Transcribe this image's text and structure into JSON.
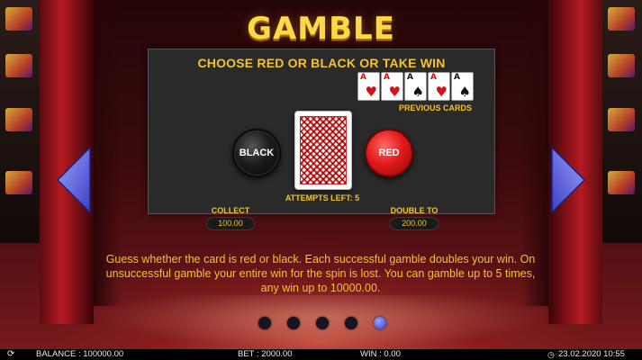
{
  "title": "GAMBLE",
  "panel": {
    "heading": "CHOOSE RED OR BLACK OR TAKE WIN",
    "previous_cards_label": "PREVIOUS CARDS",
    "previous_cards": [
      {
        "rank": "A",
        "suit": "♥",
        "color": "red"
      },
      {
        "rank": "A",
        "suit": "♥",
        "color": "red"
      },
      {
        "rank": "A",
        "suit": "♠",
        "color": "black"
      },
      {
        "rank": "A",
        "suit": "♥",
        "color": "red"
      },
      {
        "rank": "A",
        "suit": "♠",
        "color": "black"
      }
    ],
    "black_label": "BLACK",
    "red_label": "RED",
    "attempts_label": "ATTEMPTS LEFT: 5",
    "collect_label": "COLLECT",
    "collect_value": "100.00",
    "double_label": "DOUBLE TO",
    "double_value": "200.00"
  },
  "description": "Guess whether the card is red or black. Each successful gamble doubles your win. On unsuccessful gamble your entire win for the spin is lost. You can gamble up to 5 times, any win up to 10000.00.",
  "pagination": {
    "count": 5,
    "active_index": 4
  },
  "bottom_bar": {
    "balance": "BALANCE : 100000.00",
    "bet": "BET : 2000.00",
    "win": "WIN : 0.00",
    "datetime": "23.02.2020 10:55"
  },
  "colors": {
    "accent_gold": "#f4c22e",
    "arrow_blue": "#5b5ee6",
    "red_button": "#e31a1a",
    "panel_bg": "#2a2a2a"
  },
  "icons": {
    "left_arrow": "triangle-left-icon",
    "right_arrow": "triangle-right-icon",
    "refresh": "refresh-icon",
    "clock": "clock-icon"
  }
}
